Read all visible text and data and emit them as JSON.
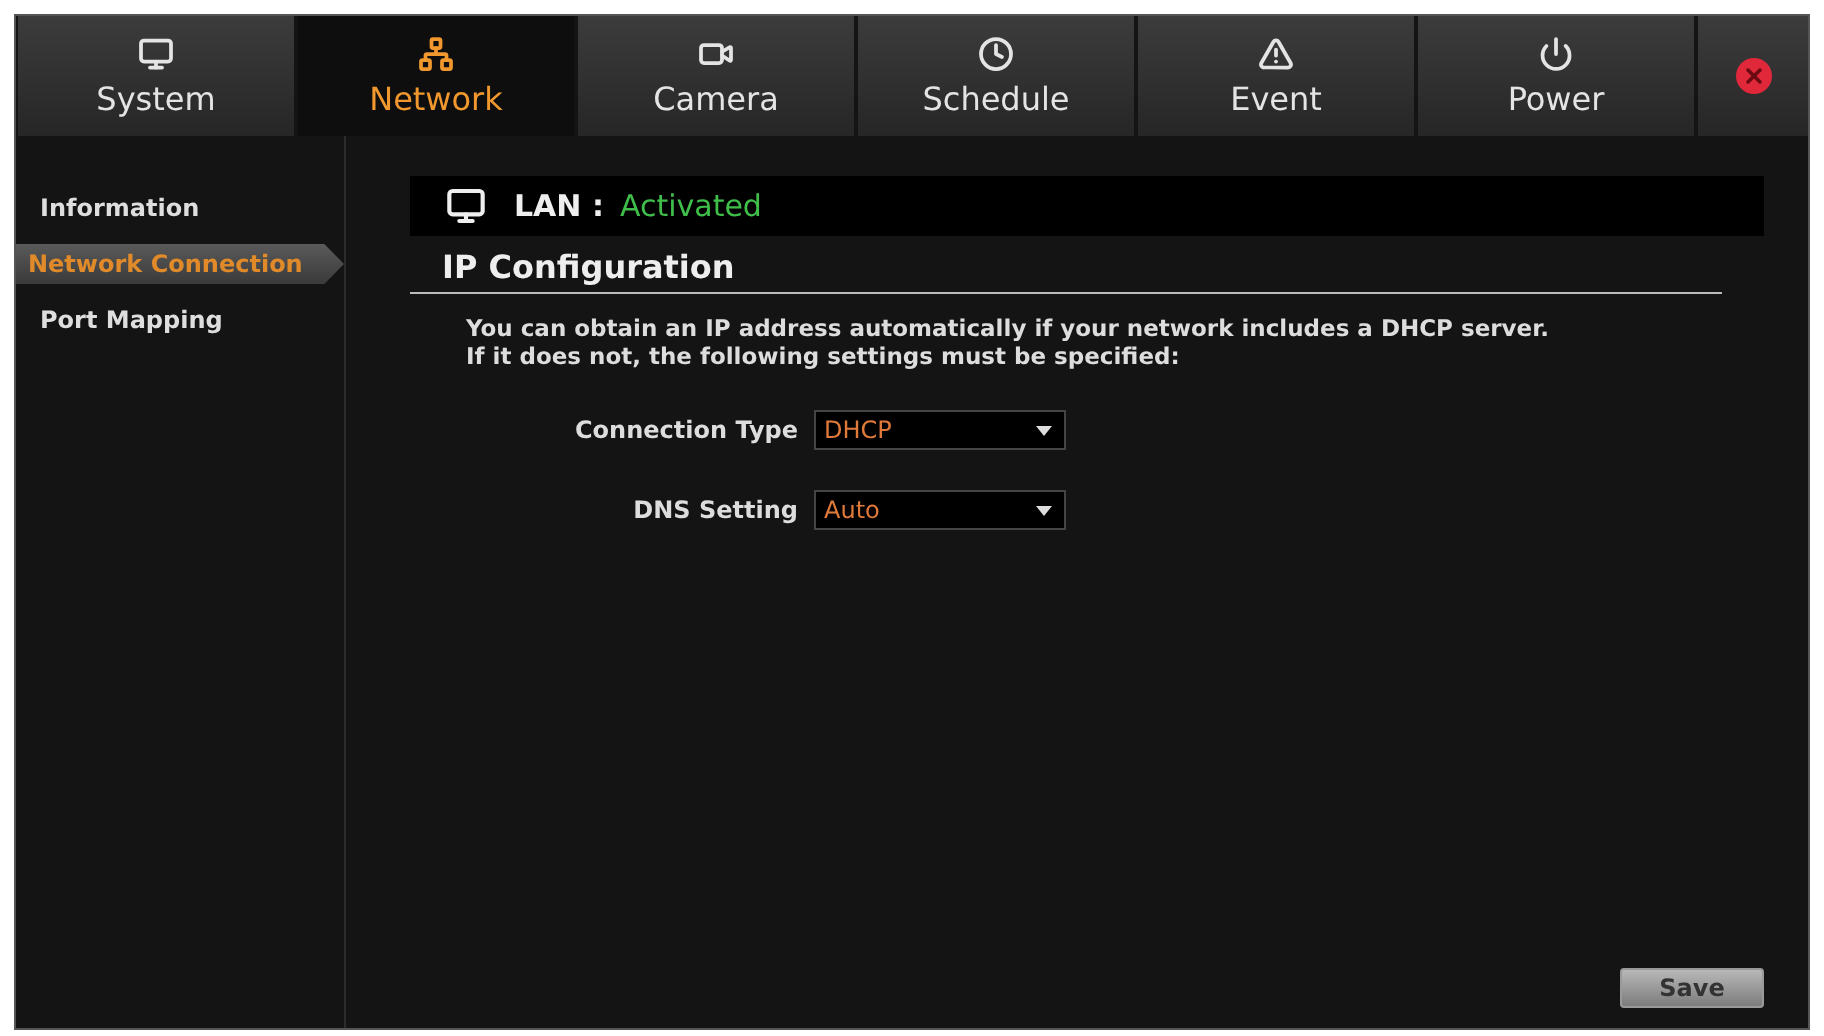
{
  "tabs": [
    {
      "label": "System",
      "kind": "system",
      "selected": false
    },
    {
      "label": "Network",
      "kind": "network",
      "selected": true
    },
    {
      "label": "Camera",
      "kind": "camera",
      "selected": false
    },
    {
      "label": "Schedule",
      "kind": "schedule",
      "selected": false
    },
    {
      "label": "Event",
      "kind": "event",
      "selected": false
    },
    {
      "label": "Power",
      "kind": "power",
      "selected": false
    }
  ],
  "sidebar": {
    "items": [
      {
        "label": "Information",
        "selected": false
      },
      {
        "label": "Network Connection",
        "selected": true
      },
      {
        "label": "Port Mapping",
        "selected": false
      }
    ]
  },
  "status": {
    "label": "LAN :",
    "value": "Activated"
  },
  "section_title": "IP Configuration",
  "description": [
    "You can obtain an IP address automatically if your network includes a DHCP server.",
    "If it does not, the following settings must be specified:"
  ],
  "fields": [
    {
      "label": "Connection Type",
      "value": "DHCP"
    },
    {
      "label": "DNS Setting",
      "value": "Auto"
    }
  ],
  "save_button": "Save"
}
